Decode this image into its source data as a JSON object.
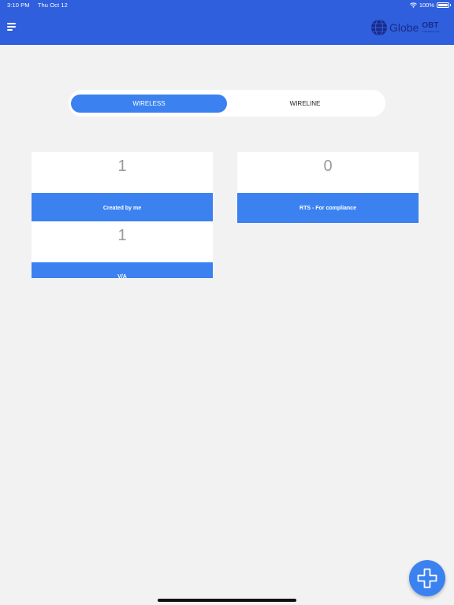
{
  "status_bar": {
    "time": "3:10 PM",
    "date": "Thu Oct 12",
    "battery": "100%"
  },
  "header": {
    "menu_icon": "hamburger-menu-icon",
    "logo_word": "Globe",
    "logo_suffix": "OBT",
    "logo_tagline": "Onboarding Tool",
    "brand_color": "#2f5fdc"
  },
  "tabs": [
    {
      "label": "WIRELESS",
      "active": true
    },
    {
      "label": "WIRELINE",
      "active": false
    }
  ],
  "cards": [
    {
      "count": "1",
      "label": "Created by me"
    },
    {
      "count": "0",
      "label": "RTS - For compliance"
    },
    {
      "count": "1",
      "label": "V/A"
    }
  ],
  "fab": {
    "icon": "plus-icon"
  },
  "accent_color": "#3b82f0"
}
